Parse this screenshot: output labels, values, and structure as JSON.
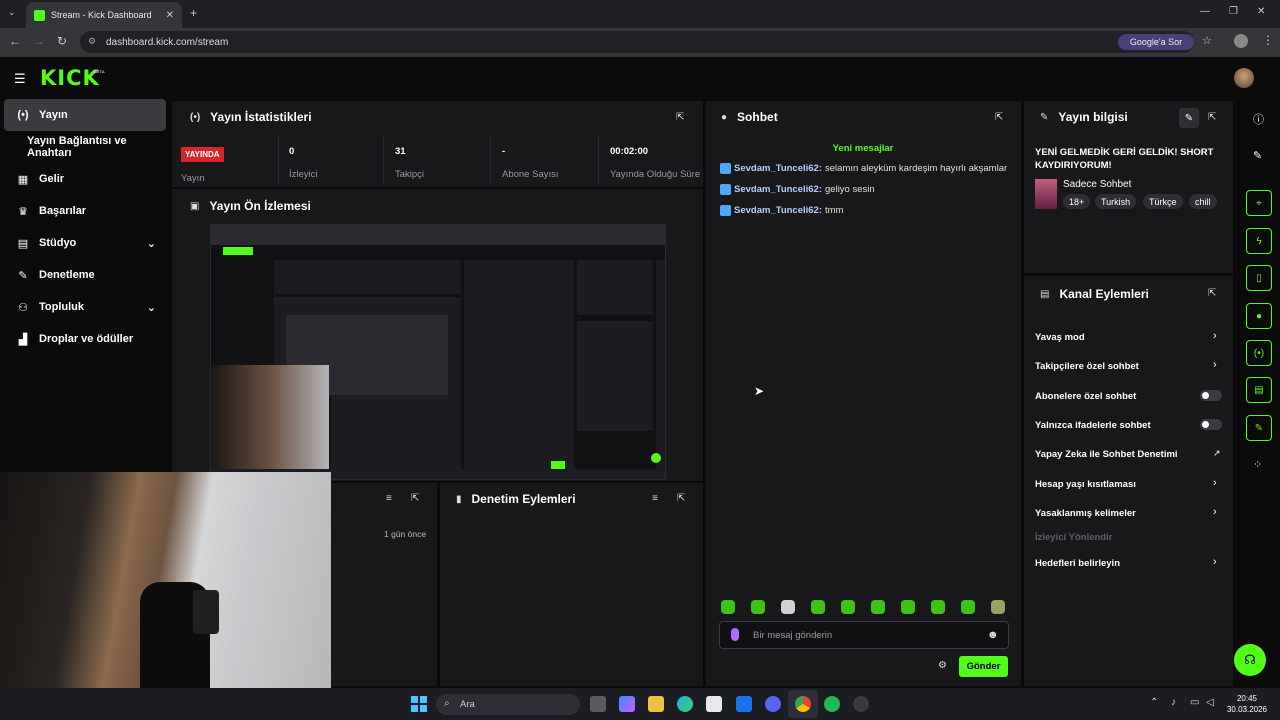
{
  "browser": {
    "tab_title": "Stream - Kick Dashboard",
    "url": "dashboard.kick.com/stream",
    "google_ask": "Google'a Sor"
  },
  "brand": {
    "logo": "KICK",
    "badge": "BETA",
    "accent": "#53fc18"
  },
  "sidebar": {
    "items": [
      {
        "label": "Yayın",
        "icon": "broadcast-icon",
        "active": true
      },
      {
        "label": "Yayın Bağlantısı ve Anahtarı",
        "icon": "",
        "active": false
      },
      {
        "label": "Gelir",
        "icon": "revenue-icon",
        "active": false
      },
      {
        "label": "Başarılar",
        "icon": "trophy-icon",
        "active": false
      },
      {
        "label": "Stüdyo",
        "icon": "studio-icon",
        "active": false,
        "expandable": true
      },
      {
        "label": "Denetleme",
        "icon": "wrench-icon",
        "active": false
      },
      {
        "label": "Topluluk",
        "icon": "community-icon",
        "active": false,
        "expandable": true
      },
      {
        "label": "Droplar ve ödüller",
        "icon": "drops-icon",
        "active": false
      }
    ]
  },
  "stats": {
    "title": "Yayın İstatistikleri",
    "status": "YAYINDA",
    "status_label": "Yayın",
    "viewers": {
      "value": "0",
      "label": "İzleyici"
    },
    "followers": {
      "value": "31",
      "label": "Takipçi"
    },
    "subscribers": {
      "value": "-",
      "label": "Abone Sayısı"
    },
    "uptime": {
      "value": "00:02:00",
      "label": "Yayında Olduğu Süre"
    }
  },
  "preview": {
    "title": "Yayın Ön İzlemesi"
  },
  "lower_left": {
    "time_ago": "1 gün önce"
  },
  "moderation": {
    "title": "Denetim Eylemleri"
  },
  "chat": {
    "title": "Sohbet",
    "new_messages": "Yeni mesajlar",
    "messages": [
      {
        "user": "Sevdam_Tunceli62:",
        "text": "selamın aleyküm kardeşim hayırlı akşamlar"
      },
      {
        "user": "Sevdam_Tunceli62:",
        "text": "geliyo sesin"
      },
      {
        "user": "Sevdam_Tunceli62:",
        "text": "tmm"
      }
    ],
    "input_placeholder": "Bir mesaj gönderin",
    "send_label": "Gönder"
  },
  "stream_info": {
    "title": "Yayın bilgisi",
    "stream_title": "YENİ GELMEDİK GERİ GELDİK! SHORT KAYDIRIYORUM!",
    "category": "Sadece Sohbet",
    "tags": [
      "18+",
      "Turkish",
      "Türkçe",
      "chill"
    ]
  },
  "channel_actions": {
    "title": "Kanal Eylemleri",
    "items": [
      {
        "label": "Yavaş mod",
        "control": "chevron"
      },
      {
        "label": "Takipçilere özel sohbet",
        "control": "chevron"
      },
      {
        "label": "Abonelere özel sohbet",
        "control": "toggle",
        "on": false
      },
      {
        "label": "Yalnızca ifadelerle sohbet",
        "control": "toggle",
        "on": false
      },
      {
        "label": "Yapay Zeka ile Sohbet Denetimi",
        "control": "external"
      },
      {
        "label": "Hesap yaşı kısıtlaması",
        "control": "chevron"
      },
      {
        "label": "Yasaklanmış kelimeler",
        "control": "chevron"
      },
      {
        "label": "İzleyici Yönlendir",
        "control": "none",
        "disabled": true
      },
      {
        "label": "Hedefleri belirleyin",
        "control": "chevron"
      }
    ]
  },
  "taskbar": {
    "search": "Ara",
    "time": "20:45",
    "date": "30.03.2026"
  }
}
